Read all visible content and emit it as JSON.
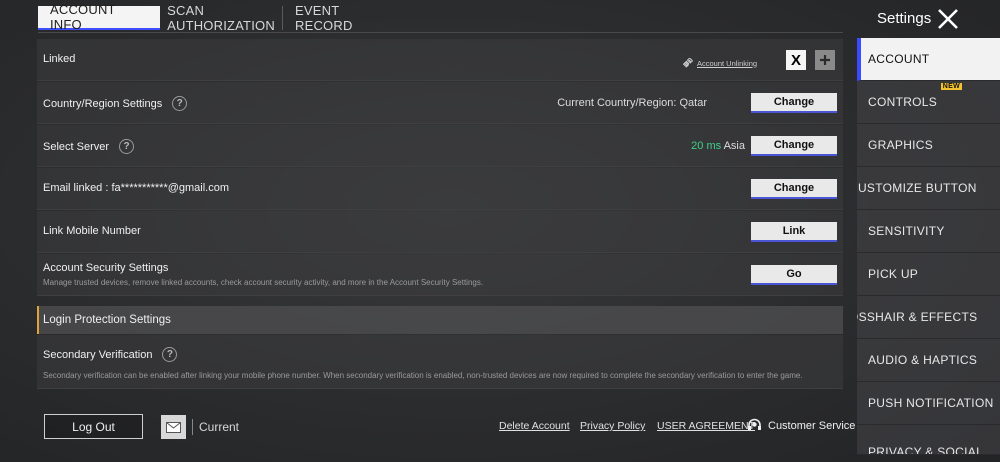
{
  "tabs": [
    "ACCOUNT INFO",
    "SCAN AUTHORIZATION",
    "EVENT RECORD"
  ],
  "header": {
    "title": "Settings"
  },
  "rows": {
    "linked": {
      "label": "Linked",
      "unlink": "Account Unlinking",
      "x_icon": "X"
    },
    "country": {
      "label": "Country/Region Settings",
      "current": "Current Country/Region: Qatar",
      "button": "Change"
    },
    "server": {
      "label": "Select Server",
      "ping": "20 ms",
      "region": "Asia",
      "button": "Change"
    },
    "email": {
      "label": "Email linked : fa***********@gmail.com",
      "button": "Change"
    },
    "mobile": {
      "label": "Link Mobile Number",
      "button": "Link"
    },
    "security": {
      "label": "Account Security Settings",
      "desc": "Manage trusted devices, remove linked accounts, check account security activity, and more in the Account Security Settings.",
      "button": "Go"
    }
  },
  "login_protection": {
    "title": "Login Protection Settings",
    "secondary_label": "Secondary Verification",
    "secondary_desc": "Secondary verification can be enabled after linking your mobile phone number. When secondary verification is enabled, non-trusted devices are now required to complete the secondary verification to enter the game."
  },
  "footer": {
    "logout": "Log Out",
    "current": "Current",
    "links": [
      "Delete Account",
      "Privacy Policy",
      "USER AGREEMENT"
    ],
    "customer_service": "Customer Service"
  },
  "sidebar": {
    "items": [
      "ACCOUNT",
      "CONTROLS",
      "GRAPHICS",
      "CUSTOMIZE BUTTON",
      "SENSITIVITY",
      "PICK UP",
      "CROSSHAIR & EFFECTS",
      "AUDIO & HAPTICS",
      "PUSH NOTIFICATION",
      "PRIVACY & SOCIAL"
    ],
    "new_badge": "NEW"
  },
  "colors": {
    "accent": "#3a4bff",
    "ping": "#3fd08a",
    "section_marker": "#e0a33a"
  }
}
